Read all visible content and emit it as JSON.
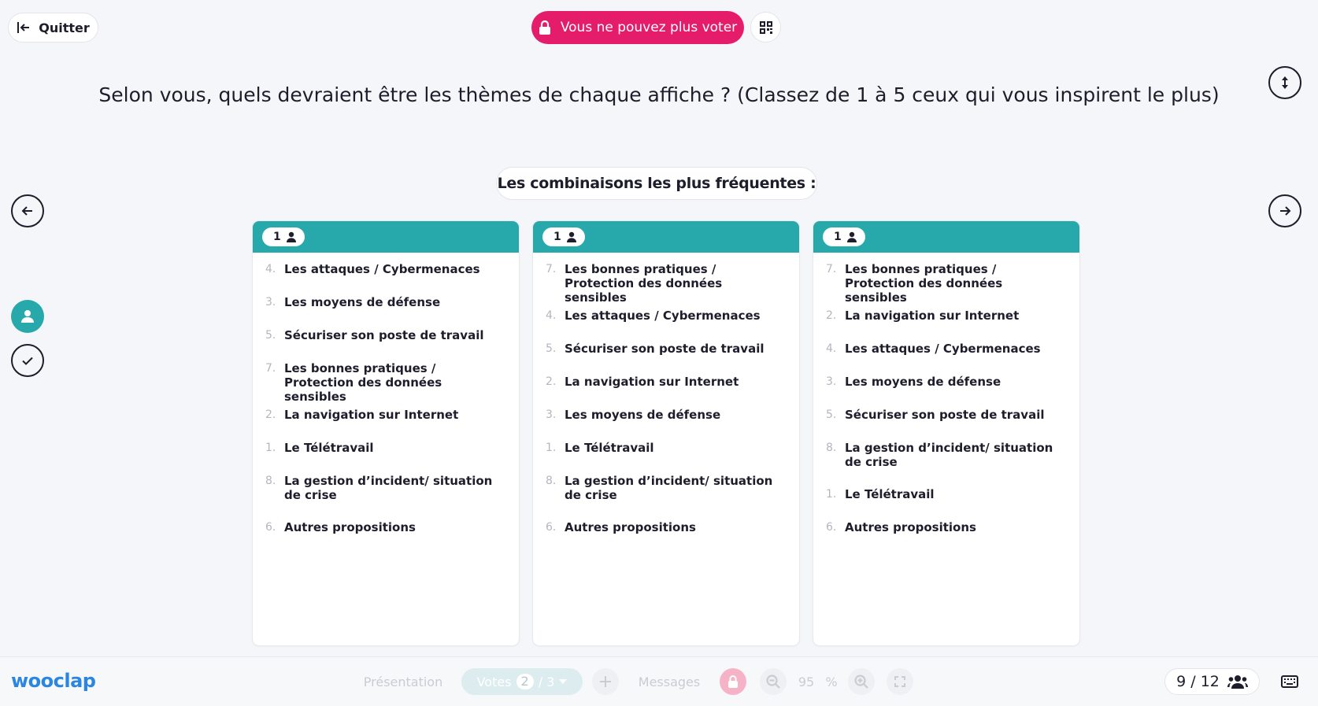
{
  "header": {
    "quit_label": "Quitter",
    "vote_status": "Vous ne pouvez plus voter"
  },
  "question": "Selon vous, quels devraient être les thèmes de chaque affiche ? (Classez de 1 à 5 ceux qui vous inspirent le plus)",
  "subtitle": "Les combinaisons les plus fréquentes :",
  "cards": [
    {
      "count": "1",
      "items": [
        {
          "num": "4.",
          "text": "Les attaques / Cybermenaces"
        },
        {
          "num": "3.",
          "text": "Les moyens de défense"
        },
        {
          "num": "5.",
          "text": "Sécuriser son poste de travail"
        },
        {
          "num": "7.",
          "text": "Les bonnes pratiques / Protection des données sensibles"
        },
        {
          "num": "2.",
          "text": "La navigation sur Internet"
        },
        {
          "num": "1.",
          "text": "Le Télétravail"
        },
        {
          "num": "8.",
          "text": "La gestion d’incident/ situation de crise"
        },
        {
          "num": "6.",
          "text": "Autres propositions"
        }
      ]
    },
    {
      "count": "1",
      "items": [
        {
          "num": "7.",
          "text": "Les bonnes pratiques / Protection des données sensibles"
        },
        {
          "num": "4.",
          "text": "Les attaques / Cybermenaces"
        },
        {
          "num": "5.",
          "text": "Sécuriser son poste de travail"
        },
        {
          "num": "2.",
          "text": "La navigation sur Internet"
        },
        {
          "num": "3.",
          "text": "Les moyens de défense"
        },
        {
          "num": "1.",
          "text": "Le Télétravail"
        },
        {
          "num": "8.",
          "text": "La gestion d’incident/ situation de crise"
        },
        {
          "num": "6.",
          "text": "Autres propositions"
        }
      ]
    },
    {
      "count": "1",
      "items": [
        {
          "num": "7.",
          "text": "Les bonnes pratiques / Protection des données sensibles"
        },
        {
          "num": "2.",
          "text": "La navigation sur Internet"
        },
        {
          "num": "4.",
          "text": "Les attaques / Cybermenaces"
        },
        {
          "num": "3.",
          "text": "Les moyens de défense"
        },
        {
          "num": "5.",
          "text": "Sécuriser son poste de travail"
        },
        {
          "num": "8.",
          "text": "La gestion d’incident/ situation de crise"
        },
        {
          "num": "1.",
          "text": "Le Télétravail"
        },
        {
          "num": "6.",
          "text": "Autres propositions"
        }
      ]
    }
  ],
  "toolbar": {
    "logo": "wooclap",
    "presentation": "Présentation",
    "votes_label": "Votes",
    "votes_current": "2",
    "votes_total": "/ 3",
    "messages": "Messages",
    "zoom_value": "95",
    "zoom_unit": "%",
    "participants": "9 / 12"
  },
  "colors": {
    "accent": "#27a9ab",
    "alert": "#e51c6a",
    "brand": "#2b86e2"
  }
}
